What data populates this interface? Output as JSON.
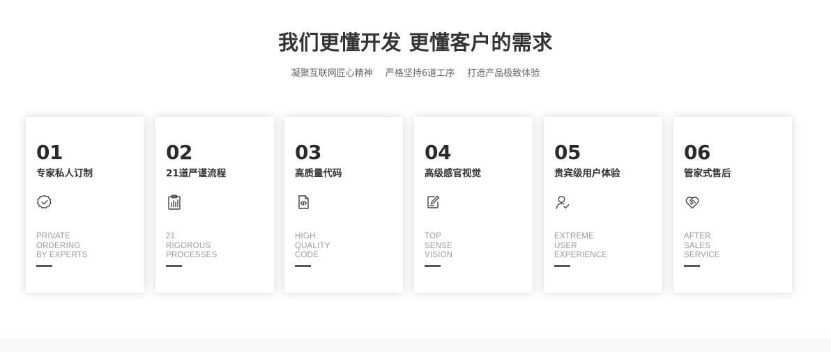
{
  "header": {
    "title": "我们更懂开发 更懂客户的需求",
    "subtitle": [
      "凝聚互联网匠心精神",
      "严格坚持6道工序",
      "打造产品极致体验"
    ]
  },
  "cards": [
    {
      "number": "01",
      "name": "专家私人订制",
      "icon": "badge-check-icon",
      "english": [
        "PRIVATE",
        "ORDERING",
        "BY EXPERTS"
      ]
    },
    {
      "number": "02",
      "name": "21道严谨流程",
      "icon": "clipboard-chart-icon",
      "english": [
        "21",
        "RIGOROUS",
        "PROCESSES"
      ]
    },
    {
      "number": "03",
      "name": "高质量代码",
      "icon": "code-file-icon",
      "english": [
        "HIGH",
        "QUALITY",
        "CODE"
      ]
    },
    {
      "number": "04",
      "name": "高级感官视觉",
      "icon": "edit-note-icon",
      "english": [
        "TOP",
        "SENSE",
        "VISION"
      ]
    },
    {
      "number": "05",
      "name": "贵宾级用户体验",
      "icon": "user-check-icon",
      "english": [
        "EXTREME",
        "USER",
        "EXPERIENCE"
      ]
    },
    {
      "number": "06",
      "name": "管家式售后",
      "icon": "heart-handshake-icon",
      "english": [
        "AFTER",
        "SALES",
        "SERVICE"
      ]
    }
  ],
  "colors": {
    "title": "#333333",
    "subtitle": "#666666",
    "english_text": "#9a9a9a",
    "accent_bar": "#555555"
  }
}
